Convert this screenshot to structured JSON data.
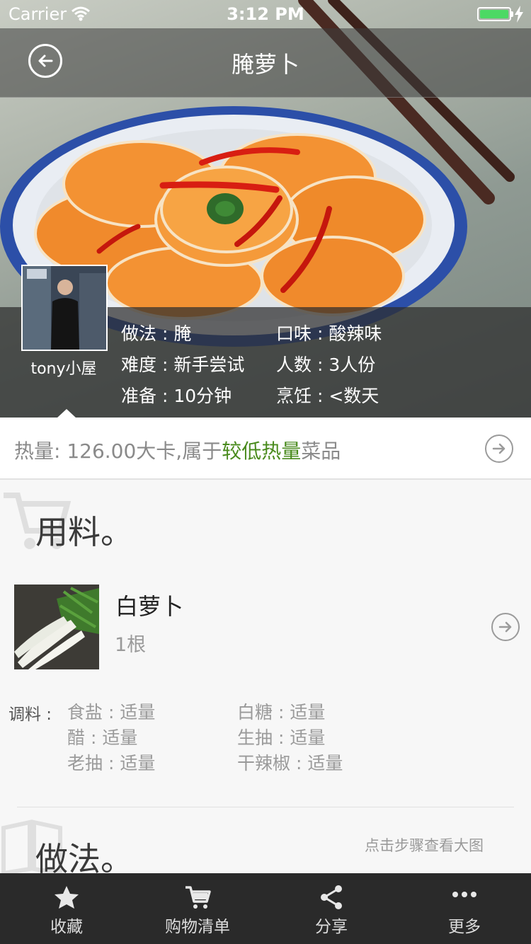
{
  "status_bar": {
    "carrier": "Carrier",
    "time": "3:12 PM",
    "battery_percent": 100,
    "battery_color": "#4cd964"
  },
  "nav": {
    "title": "腌萝卜",
    "back_icon": "back-arrow-circle-icon"
  },
  "recipe_info": {
    "author": "tony小屋",
    "method": "做法 : 腌",
    "taste": "口味 : 酸辣味",
    "difficulty": "难度 : 新手尝试",
    "servings": "人数 : 3人份",
    "prep": "准备 : 10分钟",
    "cook": "烹饪 : <数天"
  },
  "calorie": {
    "prefix": "热量: 126.00大卡,属于",
    "highlight": "较低热量",
    "suffix": "菜品",
    "highlight_color": "#4a8b1e"
  },
  "ingredients": {
    "title": "用料。",
    "main": [
      {
        "name": "白萝卜",
        "quantity": "1根"
      }
    ],
    "seasoning_label": "调料 :",
    "seasonings": [
      "食盐 : 适量",
      "白糖 : 适量",
      "醋 : 适量",
      "生抽 : 适量",
      "老抽 : 适量",
      "干辣椒 : 适量"
    ]
  },
  "steps": {
    "title": "做法。",
    "hint": "点击步骤查看大图"
  },
  "tabbar": [
    {
      "label": "收藏",
      "icon": "star-icon"
    },
    {
      "label": "购物清单",
      "icon": "cart-icon"
    },
    {
      "label": "分享",
      "icon": "share-icon"
    },
    {
      "label": "更多",
      "icon": "more-icon"
    }
  ]
}
